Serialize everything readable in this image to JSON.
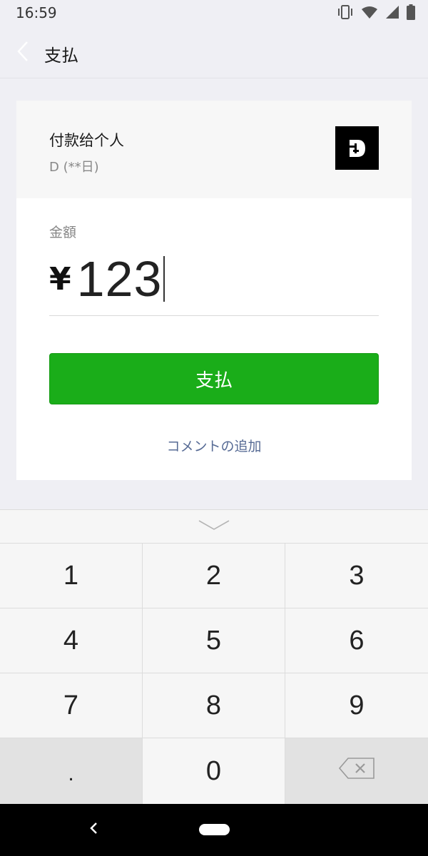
{
  "status_bar": {
    "time": "16:59",
    "icons": [
      "vibrate-icon",
      "wifi-icon",
      "signal-icon",
      "battery-icon"
    ]
  },
  "header": {
    "title": "支払",
    "back_icon": "chevron-left-icon"
  },
  "payee": {
    "title": "付款给个人",
    "name": "D (**日)",
    "avatar_letter": "D"
  },
  "amount": {
    "label": "金額",
    "currency": "¥",
    "value": "123"
  },
  "pay_button": {
    "label": "支払"
  },
  "comment_link": {
    "label": "コメントの追加"
  },
  "keypad": {
    "collapse_icon": "chevron-down-icon",
    "keys": [
      "1",
      "2",
      "3",
      "4",
      "5",
      "6",
      "7",
      "8",
      "9",
      ".",
      "0"
    ],
    "delete_icon": "backspace-icon"
  },
  "colors": {
    "accent_green": "#1aad19",
    "link_blue": "#576b95",
    "background": "#efeff4"
  }
}
